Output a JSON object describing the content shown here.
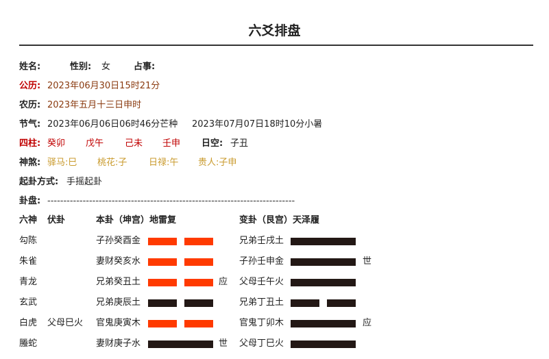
{
  "title": "六爻排盘",
  "info": {
    "name_label": "姓名:",
    "gender_label": "性别:",
    "gender_value": "女",
    "matter_label": "占事:",
    "solar_label": "公历:",
    "solar_value": "2023年06月30日15时21分",
    "lunar_label": "农历:",
    "lunar_value": "2023年五月十三日申时",
    "term_label": "节气:",
    "term_value_1": "2023年06月06日06时46分芒种",
    "term_value_2": "2023年07月07日18时10分小暑",
    "pillars_label": "四柱:",
    "pillars": [
      "癸卯",
      "戊午",
      "己未",
      "壬申"
    ],
    "void_label": "日空:",
    "void_value": "子丑",
    "gods_label": "神煞:",
    "gods": [
      "驿马:巳",
      "桃花:子",
      "日禄:午",
      "贵人:子申"
    ],
    "method_label": "起卦方式:",
    "method_value": "手摇起卦",
    "pan_label": "卦盘:",
    "pan_dashes": "-----------------------------------------------------------------------------"
  },
  "table": {
    "headers": {
      "liushen": "六神",
      "fugua": "伏卦",
      "bengua": "本卦（坤宫）地雷复",
      "biangua": "变卦（艮宫）天泽履"
    },
    "rows": [
      {
        "shen": "勾陈",
        "fu": "",
        "ben": "子孙癸酉金",
        "ben_line": "yin",
        "ben_mark": "",
        "bian": "兄弟壬戌土",
        "bian_line": "yang",
        "bian_mark": ""
      },
      {
        "shen": "朱雀",
        "fu": "",
        "ben": "妻财癸亥水",
        "ben_line": "yin",
        "ben_mark": "",
        "bian": "子孙壬申金",
        "bian_line": "yang",
        "bian_mark": "世"
      },
      {
        "shen": "青龙",
        "fu": "",
        "ben": "兄弟癸丑土",
        "ben_line": "yin",
        "ben_mark": "应",
        "bian": "父母壬午火",
        "bian_line": "yang",
        "bian_mark": ""
      },
      {
        "shen": "玄武",
        "fu": "",
        "ben": "兄弟庚辰土",
        "ben_line": "yin_dark",
        "ben_mark": "",
        "bian": "兄弟丁丑土",
        "bian_line": "yin_dark",
        "bian_mark": ""
      },
      {
        "shen": "白虎",
        "fu": "父母巳火",
        "ben": "官鬼庚寅木",
        "ben_line": "yin",
        "ben_mark": "",
        "bian": "官鬼丁卯木",
        "bian_line": "yang",
        "bian_mark": "应"
      },
      {
        "shen": "螣蛇",
        "fu": "",
        "ben": "妻财庚子水",
        "ben_line": "yang",
        "ben_mark": "世",
        "bian": "父母丁巳火",
        "bian_line": "yang",
        "bian_mark": ""
      }
    ]
  },
  "colors": {
    "moving_line": "#ff3a00",
    "static_line": "#231815",
    "pillar_text": "#c00000",
    "date_text": "#8a3a0f",
    "gods_text": "#c99a2c"
  }
}
